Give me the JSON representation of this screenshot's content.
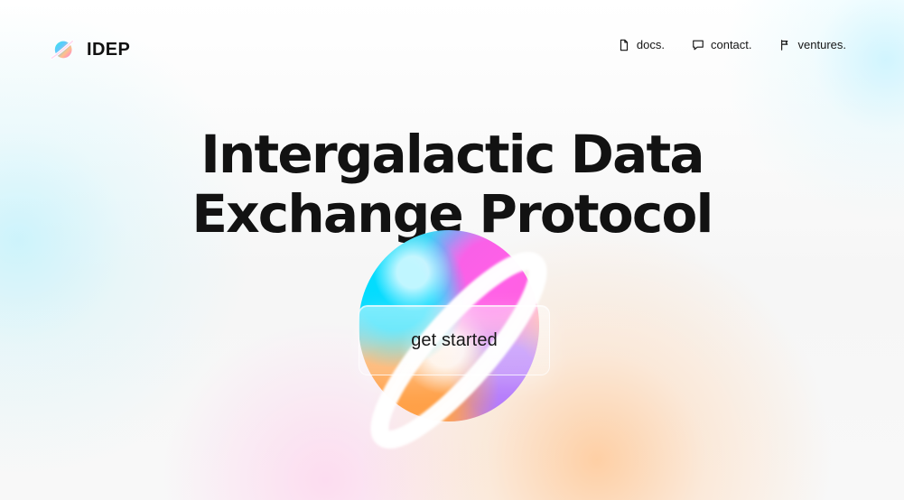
{
  "brand": {
    "name": "IDEP"
  },
  "nav": {
    "items": [
      {
        "label": "docs.",
        "icon": "document-icon"
      },
      {
        "label": "contact.",
        "icon": "chat-icon"
      },
      {
        "label": "ventures.",
        "icon": "flag-icon"
      }
    ]
  },
  "hero": {
    "title": "Intergalactic Data\nExchange Protocol",
    "cta": "get started"
  },
  "colors": {
    "text": "#121212",
    "background": "#f8f8f8",
    "accent_cyan": "#48c8ff",
    "accent_pink": "#ff6fda",
    "accent_orange": "#ffb36f"
  }
}
